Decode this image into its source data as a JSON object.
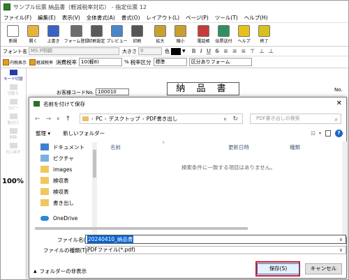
{
  "app": {
    "title": "サンプル伝票 納品書（軽減税率対応） - 指定伝票 12"
  },
  "menu": [
    "ファイル(F)",
    "編集(E)",
    "表示(V)",
    "全体書式(A)",
    "書式(O)",
    "レイアウト(L)",
    "ページ(P)",
    "ツール(T)",
    "ヘルプ(H)"
  ],
  "toolbar": [
    {
      "label": "新規",
      "icon": "new-file-icon",
      "color": "#ffffff"
    },
    {
      "label": "開く",
      "icon": "open-folder-icon",
      "color": "#e8b33c"
    },
    {
      "label": "上書き",
      "icon": "save-icon",
      "color": "#3a62c4"
    },
    {
      "label": "フォーム登録",
      "icon": "form-register-icon",
      "color": "#6d6d6d"
    },
    {
      "label": "印刷設定",
      "icon": "print-settings-icon",
      "color": "#5a5a5a"
    },
    {
      "label": "プレビュー",
      "icon": "preview-icon",
      "color": "#4a86c8"
    },
    {
      "label": "印刷",
      "icon": "printer-icon",
      "color": "#555555"
    },
    {
      "label": "拡大",
      "icon": "zoom-in-icon",
      "color": "#c8a030"
    },
    {
      "label": "縮小",
      "icon": "zoom-out-icon",
      "color": "#c8a030"
    },
    {
      "label": "電話帳",
      "icon": "phonebook-icon",
      "color": "#c73b3b"
    },
    {
      "label": "伝票送付",
      "icon": "send-slip-icon",
      "color": "#2f8f5f"
    },
    {
      "label": "ヘルプ",
      "icon": "help-icon",
      "color": "#e7c020"
    },
    {
      "label": "終了",
      "icon": "exit-icon",
      "color": "#d8c020"
    }
  ],
  "fontbar": {
    "font_label": "フォント名",
    "font_value": "MS P明朝",
    "size_label": "大きさ",
    "size_value": "9",
    "color_label": "色",
    "format_buttons": [
      "B",
      "I",
      "U",
      "S"
    ]
  },
  "taxbar": {
    "check1": "内税表示",
    "check2": "軽減税率",
    "rate_label": "消費税率",
    "rate_value": "10(軽8)",
    "rate_unit": "%",
    "kubun_label": "税率区分",
    "kubun_value": "標準",
    "kubun_form": "区分ありフォーム"
  },
  "sidebar": [
    {
      "label": "モード切替",
      "icon": "mode-switch-icon",
      "active": true
    },
    {
      "label": "切取り",
      "icon": "cut-icon",
      "active": false
    },
    {
      "label": "コピー",
      "icon": "copy-icon",
      "active": false
    },
    {
      "label": "貼付け",
      "icon": "paste-icon",
      "active": false
    },
    {
      "label": "削除",
      "icon": "delete-icon",
      "active": false
    },
    {
      "label": "元に戻す",
      "icon": "undo-icon",
      "active": false
    }
  ],
  "zoom": "100%",
  "document": {
    "title": "納 品 書",
    "customer_label": "お客様コードNo.",
    "customer_value": "100010",
    "right_label": "No."
  },
  "dialog": {
    "title": "名前を付けて保存",
    "breadcrumb": [
      "PC",
      "デスクトップ",
      "PDF書き出し"
    ],
    "search_placeholder": "PDF書き出しの検索",
    "organize": "整理 ▾",
    "new_folder": "新しいフォルダー",
    "nav": [
      {
        "label": "ドキュメント",
        "type": "doc2",
        "pin": true
      },
      {
        "label": "ピクチャ",
        "type": "pic",
        "pin": true
      },
      {
        "label": "images",
        "type": "folder",
        "pin": false
      },
      {
        "label": "検収表",
        "type": "folder",
        "pin": false
      },
      {
        "label": "検収表",
        "type": "folder",
        "pin": false
      },
      {
        "label": "書き出し",
        "type": "folder",
        "pin": false
      },
      {
        "label": "OneDrive",
        "type": "od",
        "pin": false
      }
    ],
    "columns": [
      "名前",
      "更新日時",
      "種類"
    ],
    "empty_message": "検索条件に一致する項目はありません。",
    "filename_label": "ファイル名(N):",
    "filename_value": "20240410_納品書",
    "filetype_label": "ファイルの種類(T):",
    "filetype_value": "PDFファイル(*.pdf)",
    "hide_folders": "フォルダーの非表示",
    "save_button": "保存(S)",
    "cancel_button": "キャンセル"
  }
}
